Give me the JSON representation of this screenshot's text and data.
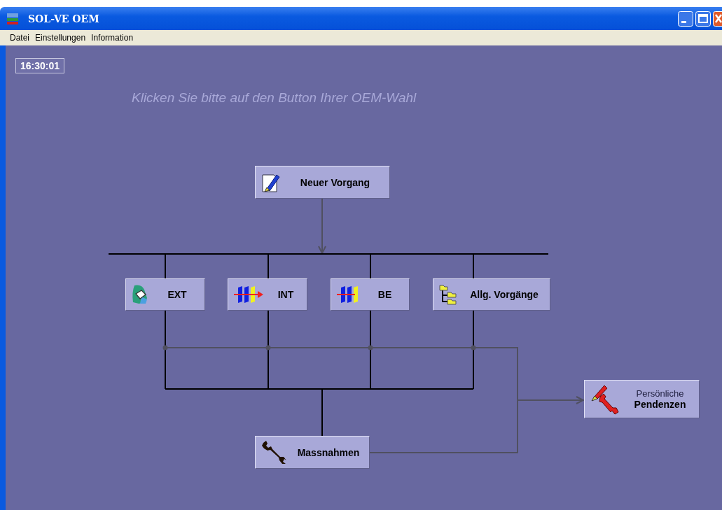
{
  "window": {
    "title": "SOL-VE OEM"
  },
  "menu": [
    "Datei",
    "Einstellungen",
    "Information"
  ],
  "clock": "16:30:01",
  "instruction": "Klicken Sie bitte auf den Button Ihrer OEM-Wahl",
  "nodes": [
    {
      "label": "Neuer Vorgang"
    },
    {
      "label": "EXT"
    },
    {
      "label": "INT"
    },
    {
      "label": "BE"
    },
    {
      "label": "Allg. Vorgänge"
    },
    {
      "label": "Massnahmen"
    },
    {
      "sublabel": "Persönliche",
      "label": "Pendenzen"
    }
  ]
}
